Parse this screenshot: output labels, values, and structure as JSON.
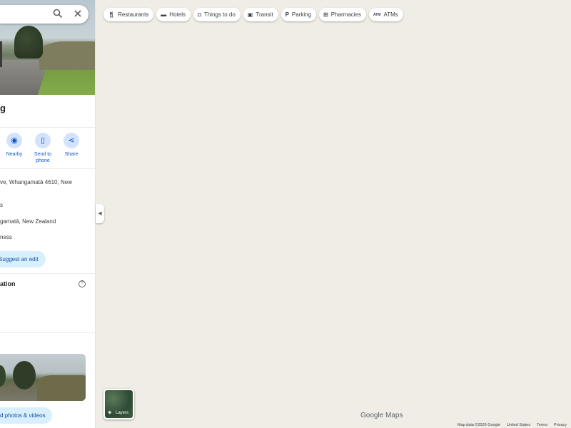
{
  "place": {
    "title": "g",
    "actions": [
      {
        "label": "Nearby",
        "icon": "nearby-icon"
      },
      {
        "label": "Send to phone",
        "icon": "phone-icon"
      },
      {
        "label": "Share",
        "icon": "share-icon"
      }
    ],
    "address": "ve, Whangamatā 4610, New",
    "line2": "s",
    "plus_code": "gamatā, New Zealand",
    "claim": "ness",
    "suggest_edit_label": "Suggest an edit",
    "section_heading": "ation",
    "add_photos_label": "d photos & videos"
  },
  "chips": [
    {
      "icon": "restaurant-icon",
      "label": "Restaurants"
    },
    {
      "icon": "hotel-icon",
      "label": "Hotels"
    },
    {
      "icon": "camera-icon",
      "label": "Things to do"
    },
    {
      "icon": "transit-icon",
      "label": "Transit"
    },
    {
      "icon": "parking-icon",
      "label": "Parking"
    },
    {
      "icon": "pharmacy-icon",
      "label": "Pharmacies"
    },
    {
      "icon": "atm-icon",
      "label": "ATMs"
    }
  ],
  "layers": {
    "label": "Layers"
  },
  "logo": {
    "text": "Google Maps"
  },
  "footer": {
    "map_data": "Map data ©2026 Google",
    "region": "United States",
    "terms": "Terms",
    "privacy": "Privacy"
  },
  "colors": {
    "map_background": "#f0ede6",
    "accent": "#0b57d0",
    "chip_button_bg": "#d8f0fb"
  }
}
